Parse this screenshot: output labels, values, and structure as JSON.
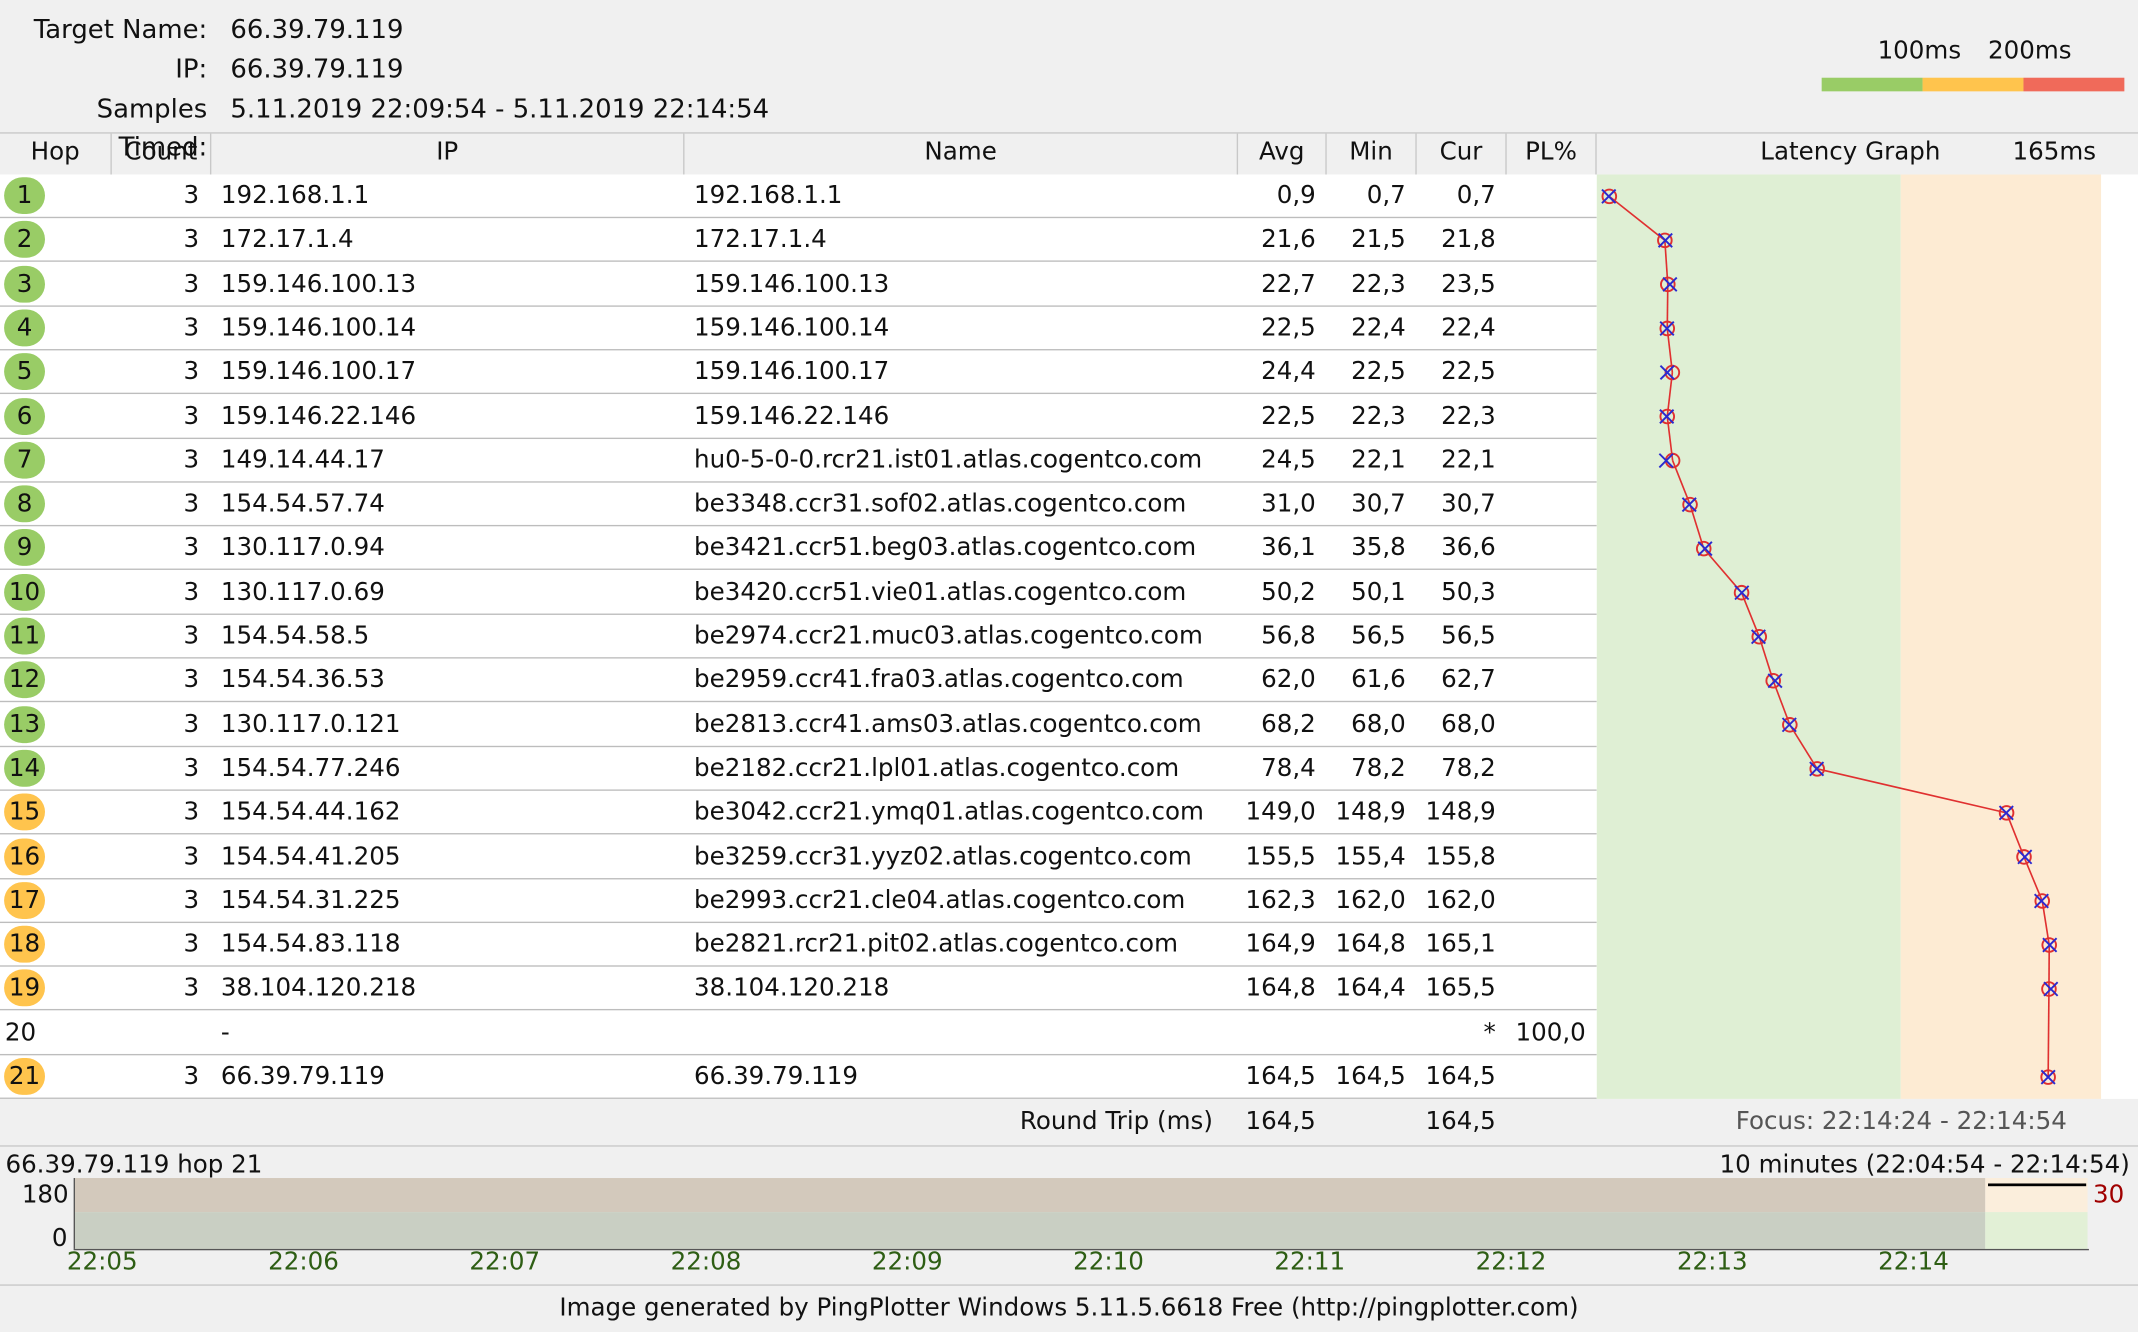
{
  "header": {
    "target_label": "Target Name:",
    "target_value": "66.39.79.119",
    "ip_label": "IP:",
    "ip_value": "66.39.79.119",
    "samples_label": "Samples Timed:",
    "samples_value": "5.11.2019 22:09:54 - 5.11.2019 22:14:54"
  },
  "legend": {
    "label_100": "100ms",
    "label_200": "200ms",
    "colors": {
      "good": "#99cc66",
      "warn": "#ffc44d",
      "bad": "#f06a5a"
    }
  },
  "columns": {
    "hop": "Hop",
    "count": "Count",
    "ip": "IP",
    "name": "Name",
    "avg": "Avg",
    "min": "Min",
    "cur": "Cur",
    "pl": "PL%",
    "graph": "Latency Graph",
    "graph_scale": "165ms"
  },
  "hops": [
    {
      "hop": "1",
      "count": "3",
      "ip": "192.168.1.1",
      "name": "192.168.1.1",
      "avg": "0,9",
      "min": "0,7",
      "cur": "0,7",
      "pl": "",
      "status": "green"
    },
    {
      "hop": "2",
      "count": "3",
      "ip": "172.17.1.4",
      "name": "172.17.1.4",
      "avg": "21,6",
      "min": "21,5",
      "cur": "21,8",
      "pl": "",
      "status": "green"
    },
    {
      "hop": "3",
      "count": "3",
      "ip": "159.146.100.13",
      "name": "159.146.100.13",
      "avg": "22,7",
      "min": "22,3",
      "cur": "23,5",
      "pl": "",
      "status": "green"
    },
    {
      "hop": "4",
      "count": "3",
      "ip": "159.146.100.14",
      "name": "159.146.100.14",
      "avg": "22,5",
      "min": "22,4",
      "cur": "22,4",
      "pl": "",
      "status": "green"
    },
    {
      "hop": "5",
      "count": "3",
      "ip": "159.146.100.17",
      "name": "159.146.100.17",
      "avg": "24,4",
      "min": "22,5",
      "cur": "22,5",
      "pl": "",
      "status": "green"
    },
    {
      "hop": "6",
      "count": "3",
      "ip": "159.146.22.146",
      "name": "159.146.22.146",
      "avg": "22,5",
      "min": "22,3",
      "cur": "22,3",
      "pl": "",
      "status": "green"
    },
    {
      "hop": "7",
      "count": "3",
      "ip": "149.14.44.17",
      "name": "hu0-5-0-0.rcr21.ist01.atlas.cogentco.com",
      "avg": "24,5",
      "min": "22,1",
      "cur": "22,1",
      "pl": "",
      "status": "green"
    },
    {
      "hop": "8",
      "count": "3",
      "ip": "154.54.57.74",
      "name": "be3348.ccr31.sof02.atlas.cogentco.com",
      "avg": "31,0",
      "min": "30,7",
      "cur": "30,7",
      "pl": "",
      "status": "green"
    },
    {
      "hop": "9",
      "count": "3",
      "ip": "130.117.0.94",
      "name": "be3421.ccr51.beg03.atlas.cogentco.com",
      "avg": "36,1",
      "min": "35,8",
      "cur": "36,6",
      "pl": "",
      "status": "green"
    },
    {
      "hop": "10",
      "count": "3",
      "ip": "130.117.0.69",
      "name": "be3420.ccr51.vie01.atlas.cogentco.com",
      "avg": "50,2",
      "min": "50,1",
      "cur": "50,3",
      "pl": "",
      "status": "green"
    },
    {
      "hop": "11",
      "count": "3",
      "ip": "154.54.58.5",
      "name": "be2974.ccr21.muc03.atlas.cogentco.com",
      "avg": "56,8",
      "min": "56,5",
      "cur": "56,5",
      "pl": "",
      "status": "green"
    },
    {
      "hop": "12",
      "count": "3",
      "ip": "154.54.36.53",
      "name": "be2959.ccr41.fra03.atlas.cogentco.com",
      "avg": "62,0",
      "min": "61,6",
      "cur": "62,7",
      "pl": "",
      "status": "green"
    },
    {
      "hop": "13",
      "count": "3",
      "ip": "130.117.0.121",
      "name": "be2813.ccr41.ams03.atlas.cogentco.com",
      "avg": "68,2",
      "min": "68,0",
      "cur": "68,0",
      "pl": "",
      "status": "green"
    },
    {
      "hop": "14",
      "count": "3",
      "ip": "154.54.77.246",
      "name": "be2182.ccr21.lpl01.atlas.cogentco.com",
      "avg": "78,4",
      "min": "78,2",
      "cur": "78,2",
      "pl": "",
      "status": "green"
    },
    {
      "hop": "15",
      "count": "3",
      "ip": "154.54.44.162",
      "name": "be3042.ccr21.ymq01.atlas.cogentco.com",
      "avg": "149,0",
      "min": "148,9",
      "cur": "148,9",
      "pl": "",
      "status": "yellow"
    },
    {
      "hop": "16",
      "count": "3",
      "ip": "154.54.41.205",
      "name": "be3259.ccr31.yyz02.atlas.cogentco.com",
      "avg": "155,5",
      "min": "155,4",
      "cur": "155,8",
      "pl": "",
      "status": "yellow"
    },
    {
      "hop": "17",
      "count": "3",
      "ip": "154.54.31.225",
      "name": "be2993.ccr21.cle04.atlas.cogentco.com",
      "avg": "162,3",
      "min": "162,0",
      "cur": "162,0",
      "pl": "",
      "status": "yellow"
    },
    {
      "hop": "18",
      "count": "3",
      "ip": "154.54.83.118",
      "name": "be2821.rcr21.pit02.atlas.cogentco.com",
      "avg": "164,9",
      "min": "164,8",
      "cur": "165,1",
      "pl": "",
      "status": "yellow"
    },
    {
      "hop": "19",
      "count": "3",
      "ip": "38.104.120.218",
      "name": "38.104.120.218",
      "avg": "164,8",
      "min": "164,4",
      "cur": "165,5",
      "pl": "",
      "status": "yellow"
    },
    {
      "hop": "20",
      "count": "",
      "ip": "-",
      "name": "",
      "avg": "",
      "min": "",
      "cur": "*",
      "pl": "100,0",
      "status": "none"
    },
    {
      "hop": "21",
      "count": "3",
      "ip": "66.39.79.119",
      "name": "66.39.79.119",
      "avg": "164,5",
      "min": "164,5",
      "cur": "164,5",
      "pl": "",
      "status": "yellow"
    }
  ],
  "graph_points": {
    "avg": [
      0.9,
      21.6,
      22.7,
      22.5,
      24.4,
      22.5,
      24.5,
      31.0,
      36.1,
      50.2,
      56.8,
      62.0,
      68.2,
      78.4,
      149.0,
      155.5,
      162.3,
      164.9,
      164.8,
      null,
      164.5
    ],
    "cur": [
      0.7,
      21.8,
      23.5,
      22.4,
      22.5,
      22.3,
      22.1,
      30.7,
      36.6,
      50.3,
      56.5,
      62.7,
      68.0,
      78.2,
      148.9,
      155.8,
      162.0,
      165.1,
      165.5,
      null,
      164.5
    ]
  },
  "graph_scale_ms": 165,
  "graph_threshold_ms": 100,
  "footer": {
    "roundtrip_label": "Round Trip (ms)",
    "roundtrip_avg": "164,5",
    "roundtrip_cur": "164,5",
    "focus": "Focus: 22:14:24 - 22:14:54"
  },
  "timeline": {
    "target_label": "66.39.79.119 hop 21",
    "range_label": "10 minutes (22:04:54 - 22:14:54)",
    "y_max": "180",
    "y_min": "0",
    "right_value": "30",
    "ticks": [
      "22:05",
      "22:06",
      "22:07",
      "22:08",
      "22:09",
      "22:10",
      "22:11",
      "22:12",
      "22:13",
      "22:14"
    ]
  },
  "credit": "Image generated by PingPlotter Windows 5.11.5.6618 Free (http://pingplotter.com)"
}
